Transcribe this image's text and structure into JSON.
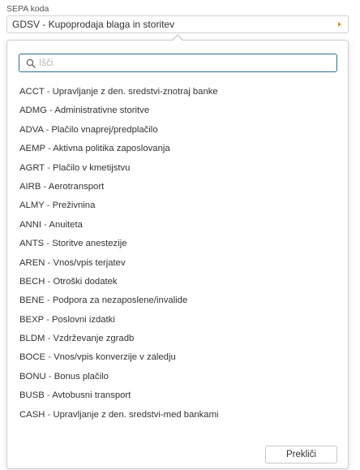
{
  "field": {
    "label": "SEPA koda",
    "selected_value": "GDSV - Kupoprodaja blaga in storitev"
  },
  "search": {
    "placeholder": "Išči",
    "value": ""
  },
  "items": [
    {
      "code": "ACCT",
      "text": "Upravljanje z den. sredstvi-znotraj banke"
    },
    {
      "code": "ADMG",
      "text": "Administrativne storitve"
    },
    {
      "code": "ADVA",
      "text": "Plačilo vnaprej/predplačilo"
    },
    {
      "code": "AEMP",
      "text": "Aktivna politika zaposlovanja"
    },
    {
      "code": "AGRT",
      "text": "Plačilo v kmetijstvu"
    },
    {
      "code": "AIRB",
      "text": "Aerotransport"
    },
    {
      "code": "ALMY",
      "text": "Preživnina"
    },
    {
      "code": "ANNI",
      "text": "Anuiteta"
    },
    {
      "code": "ANTS",
      "text": "Storitve anestezije"
    },
    {
      "code": "AREN",
      "text": "Vnos/vpis terjatev"
    },
    {
      "code": "BECH",
      "text": "Otroški dodatek"
    },
    {
      "code": "BENE",
      "text": "Podpora za nezaposlene/invalide"
    },
    {
      "code": "BEXP",
      "text": "Poslovni izdatki"
    },
    {
      "code": "BLDM",
      "text": "Vzdrževanje zgradb"
    },
    {
      "code": "BOCE",
      "text": "Vnos/vpis konverzije v zaledju"
    },
    {
      "code": "BONU",
      "text": "Bonus plačilo"
    },
    {
      "code": "BUSB",
      "text": "Avtobusni transport"
    },
    {
      "code": "CASH",
      "text": "Upravljanje z den. sredstvi-med bankami"
    }
  ],
  "separator": " - ",
  "buttons": {
    "cancel_label": "Prekliči"
  },
  "colors": {
    "search_border": "#2f6f8f",
    "caret": "#c79a2a"
  },
  "icons": {
    "search": "search-icon",
    "caret": "caret-right-icon"
  }
}
